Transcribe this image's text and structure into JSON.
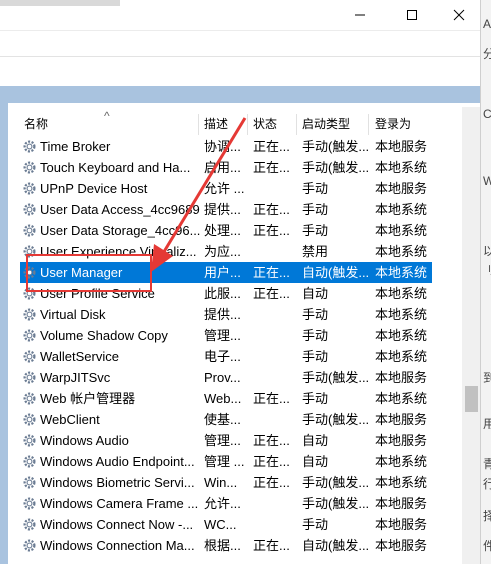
{
  "window": {
    "controls": {
      "minimize": "–",
      "maximize": "□",
      "close": "✕"
    }
  },
  "colors": {
    "selected_row": "#0078d7",
    "header_band": "#a9c3df",
    "highlight": "#e53935",
    "gear_icon": "#6b7c93"
  },
  "columns": {
    "name": "名称",
    "description": "描述",
    "status": "状态",
    "startup_type": "启动类型",
    "logon_as": "登录为"
  },
  "services": [
    {
      "name": "Time Broker",
      "description": "协调...",
      "status": "正在...",
      "startup": "手动(触发...",
      "logon": "本地服务"
    },
    {
      "name": "Touch Keyboard and Ha...",
      "description": "启用...",
      "status": "正在...",
      "startup": "手动(触发...",
      "logon": "本地系统"
    },
    {
      "name": "UPnP Device Host",
      "description": "允许 ...",
      "status": "",
      "startup": "手动",
      "logon": "本地服务"
    },
    {
      "name": "User Data Access_4cc9689",
      "description": "提供...",
      "status": "正在...",
      "startup": "手动",
      "logon": "本地系统"
    },
    {
      "name": "User Data Storage_4cc96...",
      "description": "处理...",
      "status": "正在...",
      "startup": "手动",
      "logon": "本地系统"
    },
    {
      "name": "User Experience Virtualiz...",
      "description": "为应...",
      "status": "",
      "startup": "禁用",
      "logon": "本地系统"
    },
    {
      "name": "User Manager",
      "description": "用户...",
      "status": "正在...",
      "startup": "自动(触发...",
      "logon": "本地系统",
      "selected": true
    },
    {
      "name": "User Profile Service",
      "description": "此服...",
      "status": "正在...",
      "startup": "自动",
      "logon": "本地系统"
    },
    {
      "name": "Virtual Disk",
      "description": "提供...",
      "status": "",
      "startup": "手动",
      "logon": "本地系统"
    },
    {
      "name": "Volume Shadow Copy",
      "description": "管理...",
      "status": "",
      "startup": "手动",
      "logon": "本地系统"
    },
    {
      "name": "WalletService",
      "description": "电子...",
      "status": "",
      "startup": "手动",
      "logon": "本地系统"
    },
    {
      "name": "WarpJITSvc",
      "description": "Prov...",
      "status": "",
      "startup": "手动(触发...",
      "logon": "本地服务"
    },
    {
      "name": "Web 帐户管理器",
      "description": "Web...",
      "status": "正在...",
      "startup": "手动",
      "logon": "本地系统"
    },
    {
      "name": "WebClient",
      "description": "使基...",
      "status": "",
      "startup": "手动(触发...",
      "logon": "本地服务"
    },
    {
      "name": "Windows Audio",
      "description": "管理...",
      "status": "正在...",
      "startup": "自动",
      "logon": "本地服务"
    },
    {
      "name": "Windows Audio Endpoint...",
      "description": "管理 ...",
      "status": "正在...",
      "startup": "自动",
      "logon": "本地系统"
    },
    {
      "name": "Windows Biometric Servi...",
      "description": "Win...",
      "status": "正在...",
      "startup": "手动(触发...",
      "logon": "本地系统"
    },
    {
      "name": "Windows Camera Frame ...",
      "description": "允许...",
      "status": "",
      "startup": "手动(触发...",
      "logon": "本地服务"
    },
    {
      "name": "Windows Connect Now -...",
      "description": "WC...",
      "status": "",
      "startup": "手动",
      "logon": "本地服务"
    },
    {
      "name": "Windows Connection Ma...",
      "description": "根据...",
      "status": "正在...",
      "startup": "自动(触发...",
      "logon": "本地服务"
    }
  ],
  "right_edge_glyphs": [
    "A",
    "分",
    "C",
    "W",
    "以",
    "刂",
    "到",
    "用",
    "青",
    "行",
    "择",
    "件"
  ]
}
